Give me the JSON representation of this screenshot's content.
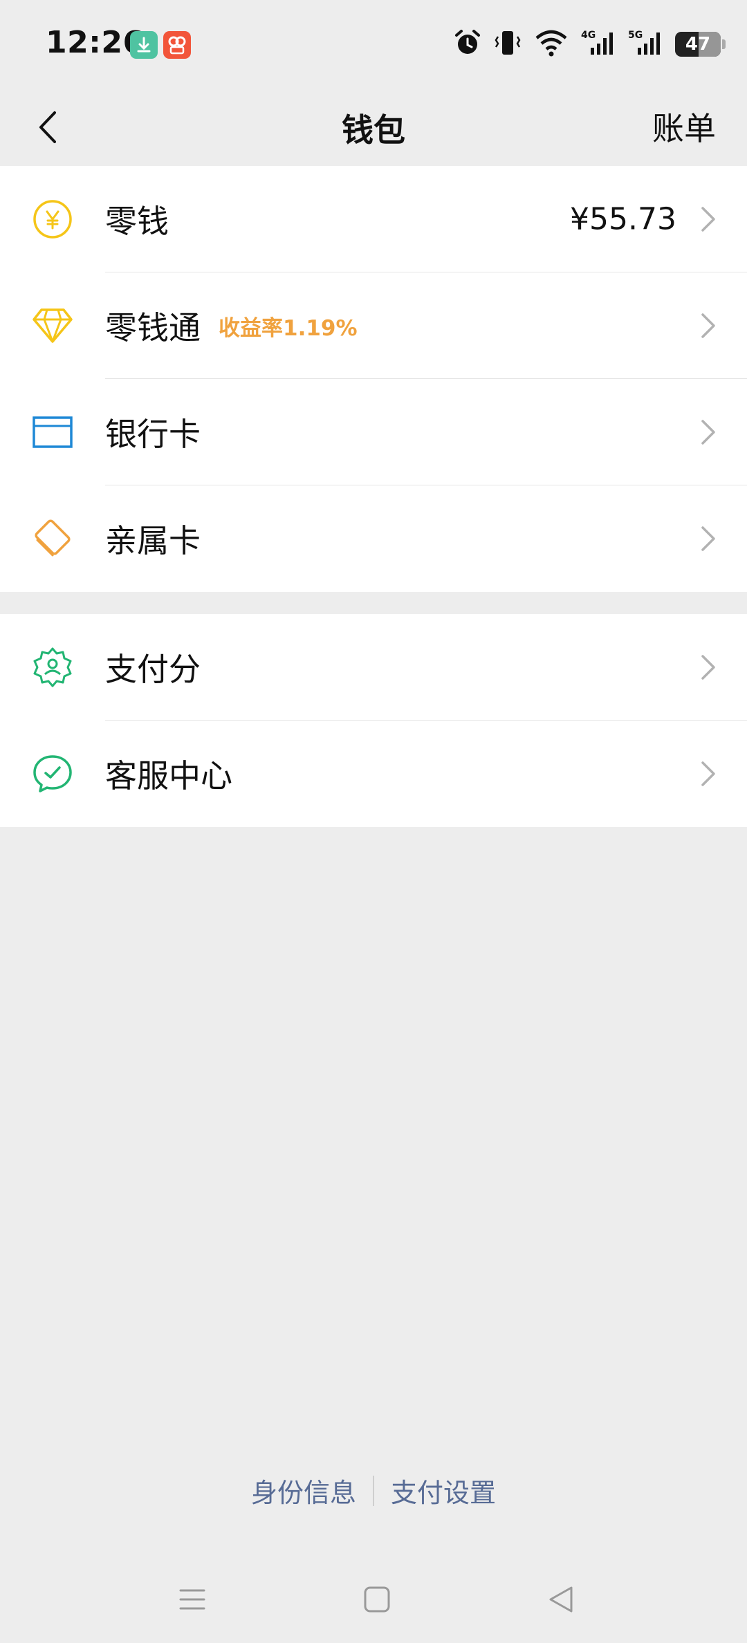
{
  "status_bar": {
    "time": "12:26",
    "battery": "47",
    "network_1": "4G",
    "network_2": "5G",
    "icons": [
      "download-icon",
      "video-app-icon",
      "alarm-icon",
      "vibrate-icon",
      "wifi-icon",
      "signal-4g-icon",
      "signal-5g-icon",
      "battery-icon"
    ]
  },
  "nav": {
    "title": "钱包",
    "right_action": "账单"
  },
  "group1": {
    "items": [
      {
        "label": "零钱",
        "value": "¥55.73",
        "icon": "yuan-coin-icon"
      },
      {
        "label": "零钱通",
        "tag": "收益率1.19%",
        "icon": "diamond-icon"
      },
      {
        "label": "银行卡",
        "icon": "bank-card-icon"
      },
      {
        "label": "亲属卡",
        "icon": "family-card-icon"
      }
    ]
  },
  "group2": {
    "items": [
      {
        "label": "支付分",
        "icon": "pay-score-badge-icon"
      },
      {
        "label": "客服中心",
        "icon": "customer-service-icon"
      }
    ]
  },
  "footer": {
    "link_identity": "身份信息",
    "link_settings": "支付设置"
  },
  "colors": {
    "background": "#ededed",
    "yellow": "#f5c518",
    "orange": "#f0a23e",
    "blue": "#1e88d6",
    "green": "#22b573",
    "link": "#576b95"
  }
}
